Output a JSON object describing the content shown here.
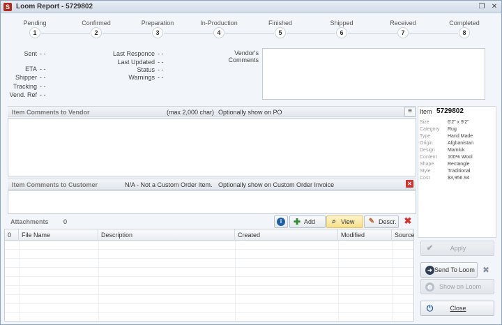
{
  "window": {
    "icon_letter": "S",
    "title": "Loom Report - 5729802",
    "restore_glyph": "❐",
    "close_glyph": "✕"
  },
  "steps": [
    {
      "label": "Pending",
      "num": "1"
    },
    {
      "label": "Confirmed",
      "num": "2"
    },
    {
      "label": "Preparation",
      "num": "3"
    },
    {
      "label": "In-Production",
      "num": "4"
    },
    {
      "label": "Finished",
      "num": "5"
    },
    {
      "label": "Shipped",
      "num": "6"
    },
    {
      "label": "Received",
      "num": "7"
    },
    {
      "label": "Completed",
      "num": "8"
    }
  ],
  "details_left": [
    {
      "label": "Sent",
      "value": "- -"
    },
    {
      "label": "ETA",
      "value": "- -"
    },
    {
      "label": "Shipper",
      "value": "- -"
    },
    {
      "label": "Tracking",
      "value": "- -"
    },
    {
      "label": "Vend. Ref",
      "value": "- -"
    }
  ],
  "details_mid": [
    {
      "label": "Last Responce",
      "value": "- -"
    },
    {
      "label": "Last Updated",
      "value": "- -"
    },
    {
      "label": "Status",
      "value": "- -"
    },
    {
      "label": "Warnings",
      "value": "- -"
    }
  ],
  "vendor_comments": {
    "label_line1": "Vendor's",
    "label_line2": "Comments",
    "value": ""
  },
  "vendor_section": {
    "title": "Item Comments to Vendor",
    "max_note": "(max 2,000 char)",
    "option_note": "Optionally show on PO",
    "value": ""
  },
  "customer_section": {
    "title": "Item Comments to Customer",
    "na_note": "N/A - Not a Custom Order Item.",
    "option_note": "Optionally show on Custom Order Invoice",
    "value": ""
  },
  "item": {
    "label": "Item",
    "number": "5729802",
    "props": [
      {
        "key": "Size",
        "value": "6'2\" x 9'2\""
      },
      {
        "key": "Category",
        "value": "Rug"
      },
      {
        "key": "Type",
        "value": "Hand Made"
      },
      {
        "key": "Origin",
        "value": "Afghanistan"
      },
      {
        "key": "Design",
        "value": "Mamluk"
      },
      {
        "key": "Content",
        "value": "100% Wool"
      },
      {
        "key": "Shape",
        "value": "Rectangle"
      },
      {
        "key": "Style",
        "value": "Traditional"
      },
      {
        "key": "Cost",
        "value": "$3,956.94"
      }
    ]
  },
  "attachments": {
    "title": "Attachments",
    "count": "0",
    "buttons": {
      "add": "Add",
      "view": "View",
      "descr": "Descr."
    },
    "columns": [
      "0",
      "File Name",
      "Description",
      "Created",
      "Modified",
      "Source"
    ]
  },
  "side_buttons": {
    "apply": "Apply",
    "send_to_loom": "Send To Loom",
    "show_on_loom": "Show on Loom",
    "close": "Close"
  },
  "colors": {
    "accent": "#1f5fa8",
    "delete": "#d0342c",
    "add": "#2e8b2e",
    "view_highlight": "#fbe9a8"
  }
}
